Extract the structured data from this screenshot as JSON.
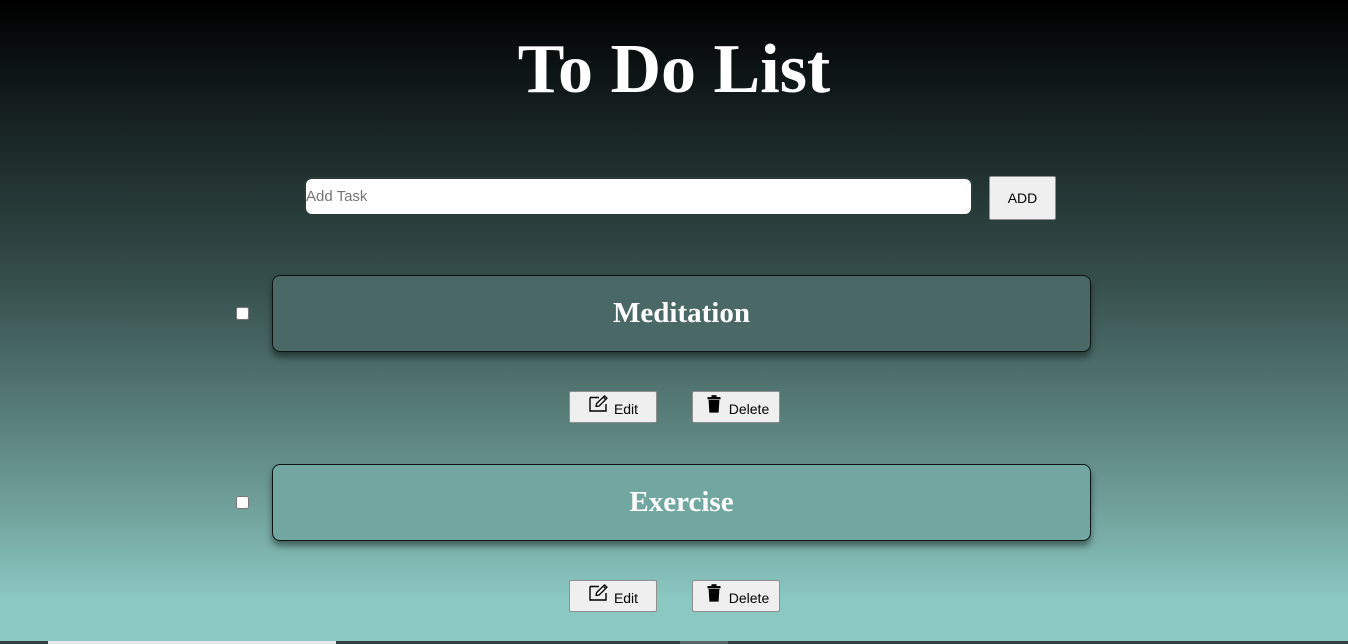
{
  "app": {
    "title": "To Do List"
  },
  "input": {
    "placeholder": "Add Task",
    "value": ""
  },
  "add_button": {
    "label": "ADD"
  },
  "tasks": [
    {
      "title": "Meditation",
      "checked": false,
      "box_color": "#4a6966",
      "edit_label": "Edit",
      "delete_label": "Delete"
    },
    {
      "title": "Exercise",
      "checked": false,
      "box_color": "#72a7a1",
      "edit_label": "Edit",
      "delete_label": "Delete"
    }
  ],
  "icons": {
    "edit": "edit-icon",
    "delete": "trash-icon"
  },
  "colors": {
    "background_top": "#000000",
    "background_bottom": "#8bc8c2",
    "title_text": "#ffffff"
  }
}
